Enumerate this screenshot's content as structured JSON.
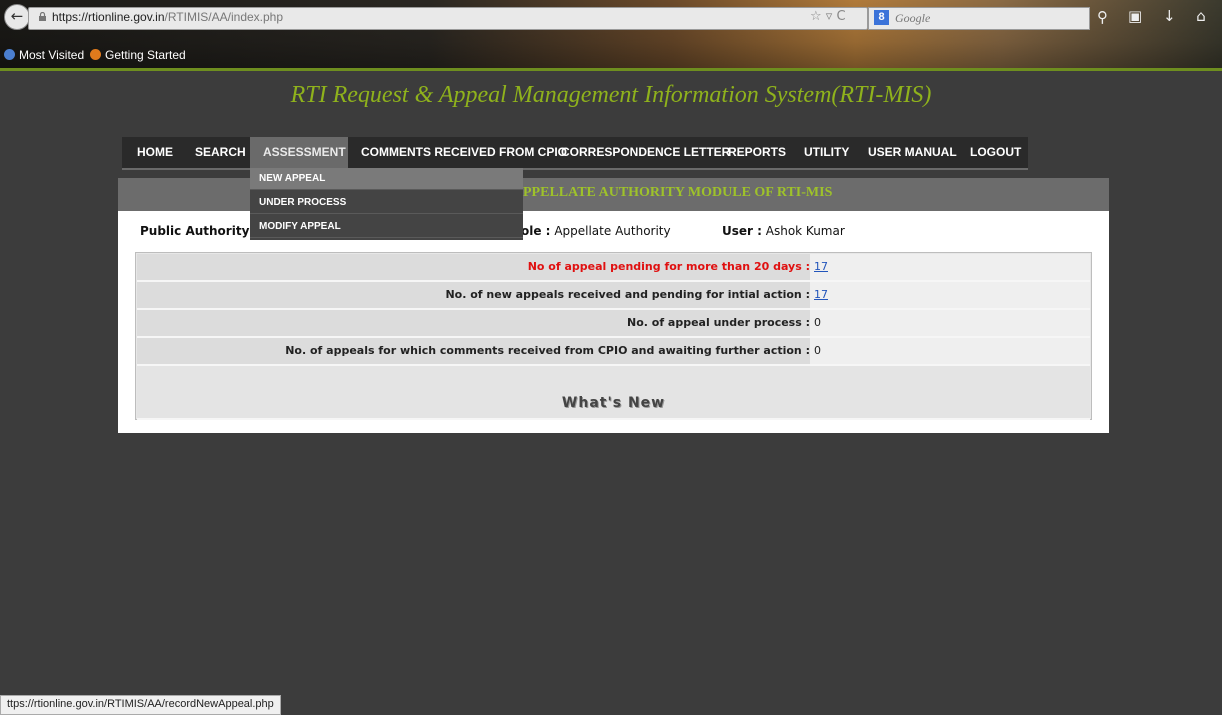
{
  "browser": {
    "url_host": "https://rtionline.gov.in",
    "url_path": "/RTIMIS/AA/index.php",
    "search_placeholder": "Google",
    "bookmarks": [
      "Most Visited",
      "Getting Started"
    ]
  },
  "page": {
    "title": "RTI Request & Appeal Management Information System(RTI-MIS)",
    "module_title": "APPELLATE AUTHORITY MODULE OF RTI-MIS",
    "module_title_visible": "PPELLATE AUTHORITY MODULE OF RTI-MIS"
  },
  "nav": {
    "items": [
      "HOME",
      "SEARCH",
      "ASSESSMENT",
      "COMMENTS RECEIVED FROM CPIO",
      "CORRESPONDENCE LETTER",
      "REPORTS",
      "UTILITY",
      "USER MANUAL",
      "LOGOUT"
    ],
    "active": "ASSESSMENT"
  },
  "dropdown": {
    "items": [
      "NEW APPEAL",
      "UNDER PROCESS",
      "MODIFY APPEAL"
    ],
    "highlighted": "NEW APPEAL"
  },
  "info": {
    "public_authority_label": "Public Authority:",
    "role_label_visible": "ole :",
    "role_value": "Appellate Authority",
    "user_label": "User :",
    "user_value": "Ashok Kumar"
  },
  "stats": [
    {
      "label": "No of appeal pending for more than 20 days :",
      "value": "17",
      "link": true,
      "alert": true
    },
    {
      "label": "No. of new appeals received and pending for intial action :",
      "value": "17",
      "link": true,
      "alert": false
    },
    {
      "label": "No. of appeal under process :",
      "value": "0",
      "link": false,
      "alert": false
    },
    {
      "label": "No. of appeals for which comments received from CPIO and awaiting further action :",
      "value": "0",
      "link": false,
      "alert": false
    }
  ],
  "whats_new": "What's New",
  "status_bar": "https://rtionline.gov.in/RTIMIS/AA/recordNewAppeal.php",
  "status_bar_visible": "ttps://rtionline.gov.in/RTIMIS/AA/recordNewAppeal.php",
  "colors": {
    "title_green": "#8fb21c",
    "alert_red": "#e01010",
    "link_blue": "#2255bb",
    "background": "#3c3c3c"
  }
}
